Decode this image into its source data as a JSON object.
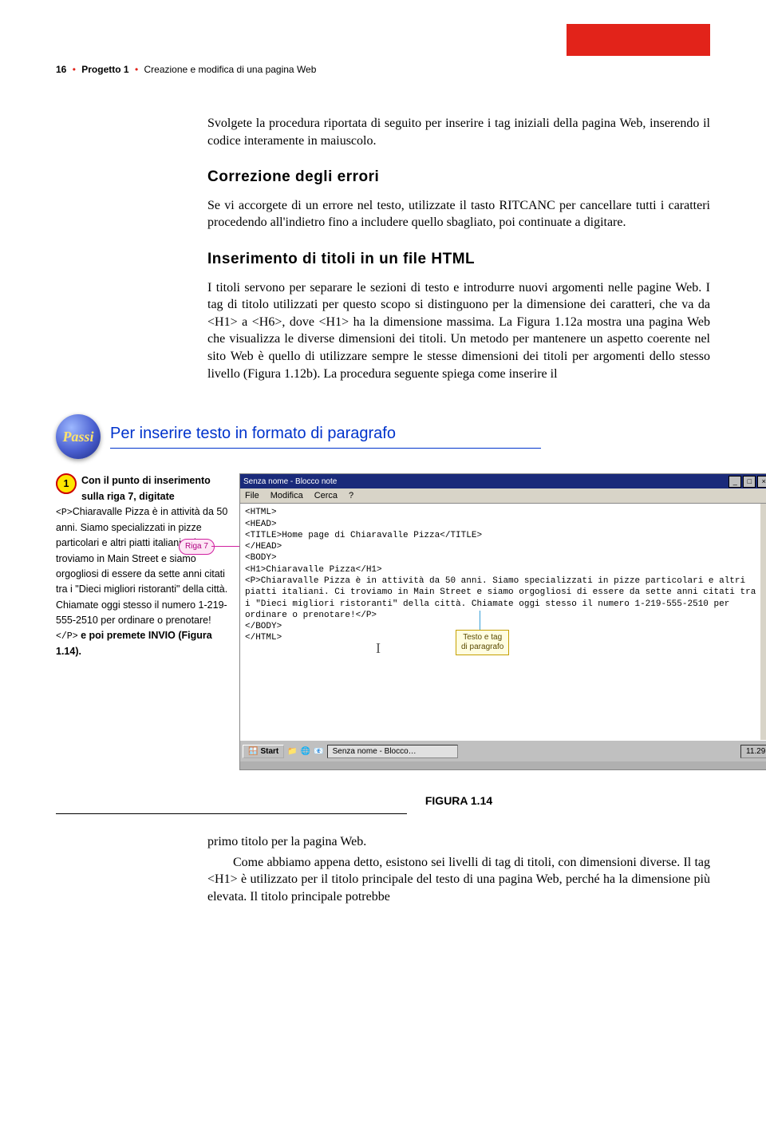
{
  "header": {
    "page_num": "16",
    "project": "Progetto 1",
    "chapter": "Creazione e modifica di una pagina Web"
  },
  "body": {
    "intro": "Svolgete la procedura riportata di seguito per inserire i tag iniziali della pagina Web, inserendo il codice interamente in maiuscolo.",
    "h1": "Correzione degli errori",
    "p1": "Se vi accorgete di un errore nel testo, utilizzate il tasto RITCANC per cancellare tutti i caratteri procedendo all'indietro fino a includere quello sbagliato, poi continuate a digitare.",
    "h2": "Inserimento di titoli in un file HTML",
    "p2": "I titoli servono per separare le sezioni di testo e introdurre nuovi argomenti nelle pagine Web. I tag di titolo utilizzati per questo scopo si distinguono per la dimensione dei caratteri, che va da <H1> a <H6>, dove <H1> ha la dimensione massima. La Figura 1.12a mostra una pagina Web che visualizza le diverse dimensioni dei titoli. Un metodo per mantenere un aspetto coerente nel sito Web è quello di utilizzare sempre le stesse dimensioni dei titoli per argomenti dello stesso livello (Figura 1.12b). La procedura seguente spiega come inserire il"
  },
  "passi": {
    "badge": "Passi",
    "title": "Per inserire testo in formato di paragrafo"
  },
  "step1": {
    "num": "1",
    "lead_bold1": "Con il punto di inserimento sulla riga 7, digitate ",
    "code1": "<P>",
    "txt1": "Chiaravalle Pizza è in attività da 50 anni. Siamo specializzati in pizze particolari e altri piatti italiani. Ci troviamo in Main Street e siamo orgogliosi di essere da sette anni citati tra i \"Dieci migliori ristoranti\" della città. Chiamate oggi stesso il numero 1-219-555-2510 per ordinare o prenotare! ",
    "code2": "</P>",
    "tail_bold": " e poi premete ",
    "tail_sc": "INVIO",
    "tail_ref": " (Figura 1.14).",
    "riga": "Riga 7"
  },
  "notepad": {
    "title": "Senza nome - Blocco note",
    "menu": {
      "file": "File",
      "edit": "Modifica",
      "search": "Cerca",
      "help": "?"
    },
    "lines": [
      "<HTML>",
      "<HEAD>",
      "<TITLE>Home page di Chiaravalle Pizza</TITLE>",
      "</HEAD>",
      "<BODY>",
      "<H1>Chiaravalle Pizza</H1>",
      "<P>Chiaravalle Pizza è in attività da 50 anni. Siamo specializzati in pizze particolari e altri",
      "piatti italiani. Ci troviamo in Main Street e siamo orgogliosi di essere da sette anni citati tra",
      "i \"Dieci migliori ristoranti\" della città. Chiamate oggi stesso il numero 1-219-555-2510 per",
      "ordinare o prenotare!</P>",
      "",
      "</BODY>",
      "</HTML>"
    ],
    "callout": "Testo e tag\ndi paragrafo",
    "taskbar": {
      "start": "Start",
      "task": "Senza nome - Blocco…",
      "time": "11.29"
    }
  },
  "figura": "FIGURA 1.14",
  "closing": {
    "p1": "primo titolo per la pagina Web.",
    "p2": "Come abbiamo appena detto, esistono sei livelli di tag di titoli, con dimensioni diverse. Il tag <H1> è utilizzato per il titolo principale del testo di una pagina Web, perché ha la dimensione più elevata. Il titolo principale potrebbe"
  }
}
